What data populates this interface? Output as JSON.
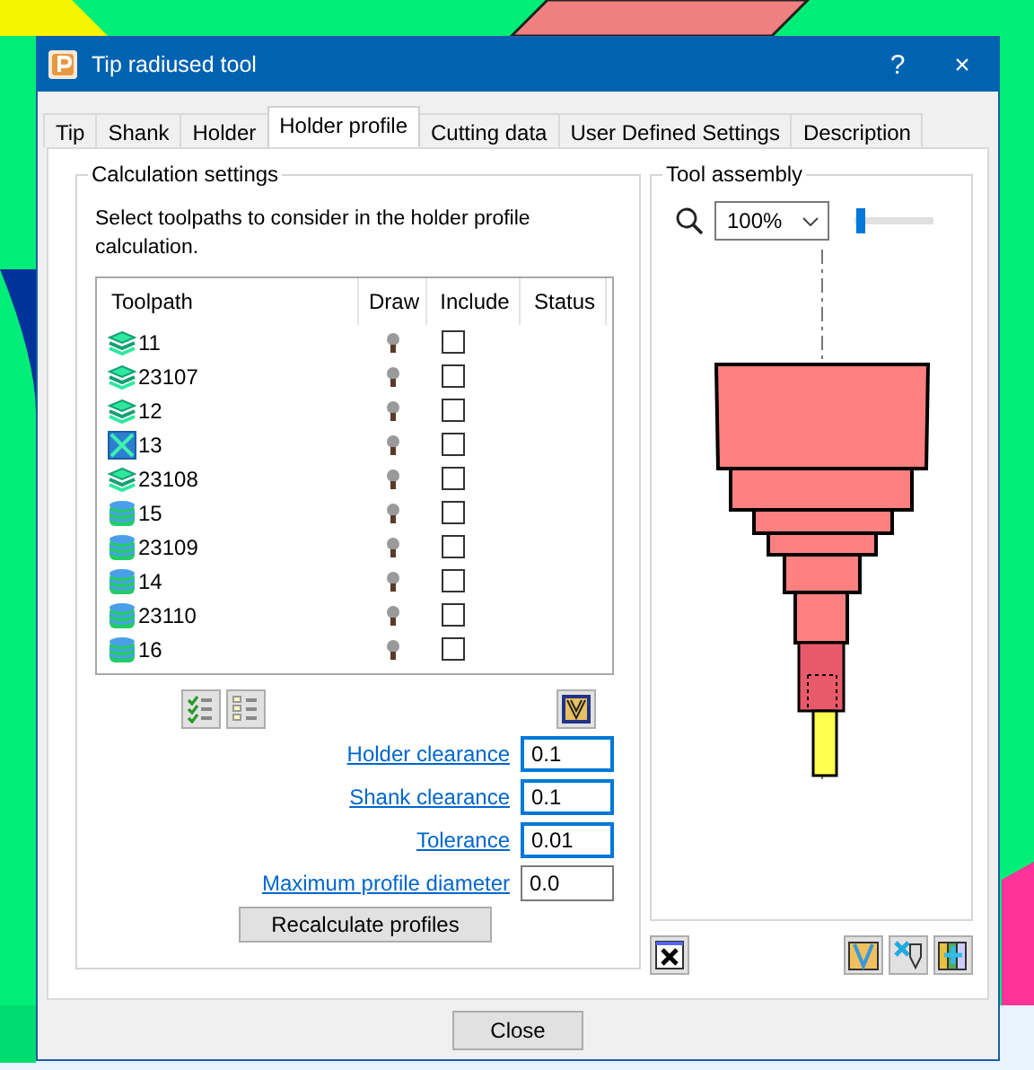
{
  "window": {
    "title": "Tip radiused tool",
    "help": "?",
    "close": "×"
  },
  "tabs": [
    {
      "label": "Tip",
      "selected": false
    },
    {
      "label": "Shank",
      "selected": false
    },
    {
      "label": "Holder",
      "selected": false
    },
    {
      "label": "Holder profile",
      "selected": true
    },
    {
      "label": "Cutting data",
      "selected": false
    },
    {
      "label": "User Defined Settings",
      "selected": false
    },
    {
      "label": "Description",
      "selected": false
    }
  ],
  "calculation": {
    "title": "Calculation settings",
    "instructions": "Select toolpaths to consider in the holder profile calculation.",
    "columns": [
      "Toolpath",
      "Draw",
      "Include",
      "Status"
    ],
    "rows": [
      {
        "kind": "layers",
        "name": "11",
        "include": false
      },
      {
        "kind": "layers",
        "name": "23107",
        "include": false
      },
      {
        "kind": "layers",
        "name": "12",
        "include": false
      },
      {
        "kind": "frame",
        "name": "13",
        "include": false
      },
      {
        "kind": "layers",
        "name": "23108",
        "include": false
      },
      {
        "kind": "stack",
        "name": "15",
        "include": false
      },
      {
        "kind": "stack",
        "name": "23109",
        "include": false
      },
      {
        "kind": "stack",
        "name": "14",
        "include": false
      },
      {
        "kind": "stack",
        "name": "23110",
        "include": false
      },
      {
        "kind": "stack",
        "name": "16",
        "include": false
      }
    ],
    "fields": [
      {
        "label": "Holder clearance",
        "value": "0.1",
        "focused": true
      },
      {
        "label": "Shank clearance",
        "value": "0.1",
        "focused": true
      },
      {
        "label": "Tolerance",
        "value": "0.01",
        "focused": true
      },
      {
        "label": "Maximum profile diameter",
        "value": "0.0",
        "focused": false
      }
    ],
    "button": "Recalculate profiles"
  },
  "assembly": {
    "title": "Tool assembly",
    "zoom": "100%",
    "slider": {
      "level": 0.02
    }
  },
  "footer": {
    "button": "Close"
  }
}
